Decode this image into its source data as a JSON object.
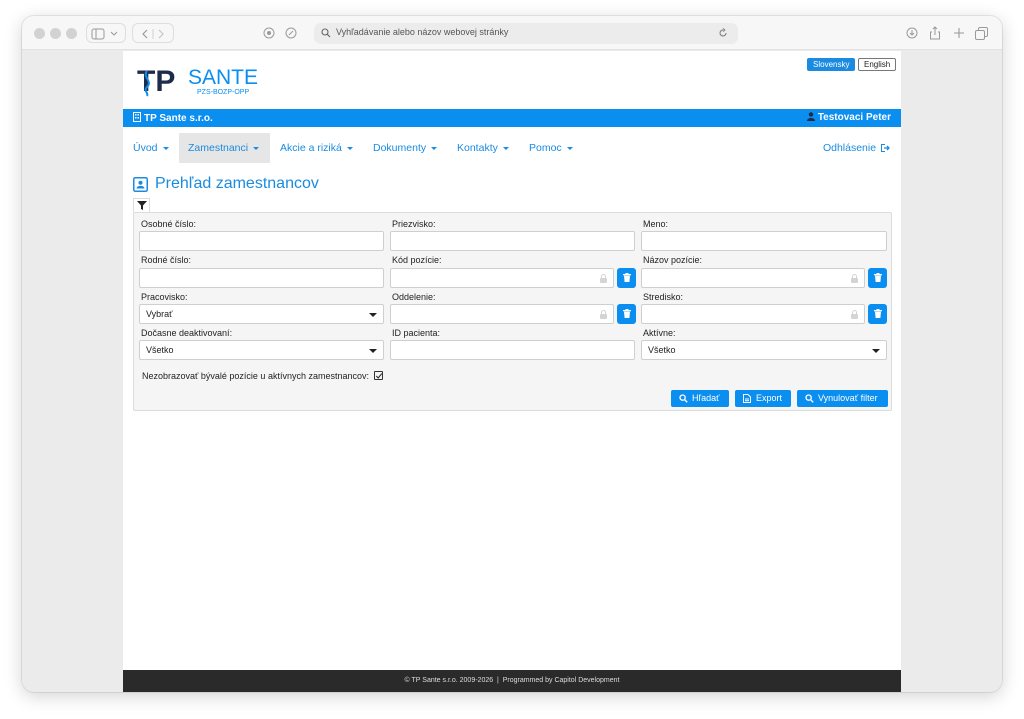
{
  "browser": {
    "address_placeholder": "Vyhľadávanie alebo názov webovej stránky"
  },
  "brand": {
    "logo_letters": "TP",
    "name": "SANTE",
    "tagline": "PZS-BOZP-OPP",
    "accent": "#0a8ef0"
  },
  "languages": {
    "sk": "Slovensky",
    "en": "English"
  },
  "topbar": {
    "company": "TP Sante s.r.o.",
    "user": "Testovaci Peter"
  },
  "nav": {
    "items": [
      {
        "label": "Úvod"
      },
      {
        "label": "Zamestnanci"
      },
      {
        "label": "Akcie a riziká"
      },
      {
        "label": "Dokumenty"
      },
      {
        "label": "Kontakty"
      },
      {
        "label": "Pomoc"
      }
    ],
    "active_index": 1,
    "logout": "Odhlásenie"
  },
  "page": {
    "title": "Prehľad zamestnancov"
  },
  "filter": {
    "fields": {
      "personal_number": {
        "label": "Osobné číslo",
        "value": ""
      },
      "surname": {
        "label": "Priezvisko",
        "value": ""
      },
      "name": {
        "label": "Meno",
        "value": ""
      },
      "birth_number": {
        "label": "Rodné číslo",
        "value": ""
      },
      "position_code": {
        "label": "Kód pozície",
        "value": ""
      },
      "position_name": {
        "label": "Názov pozície",
        "value": ""
      },
      "workplace": {
        "label": "Pracovisko",
        "value": "Vybrať"
      },
      "department": {
        "label": "Oddelenie",
        "value": ""
      },
      "center": {
        "label": "Stredisko",
        "value": ""
      },
      "temp_deactivated": {
        "label": "Dočasne deaktivovaní",
        "value": "Všetko"
      },
      "patient_id": {
        "label": "ID pacienta",
        "value": ""
      },
      "active": {
        "label": "Aktívne",
        "value": "Všetko"
      }
    },
    "hide_former_positions": {
      "label": "Nezobrazovať bývalé pozície u aktívnych zamestnancov:",
      "checked": true
    },
    "buttons": {
      "search": "Hľadať",
      "export": "Export",
      "reset": "Vynulovať filter"
    }
  },
  "footer": {
    "text": "© TP Sante s.r.o. 2009-2026  |  Programmed by Capitol Development"
  }
}
